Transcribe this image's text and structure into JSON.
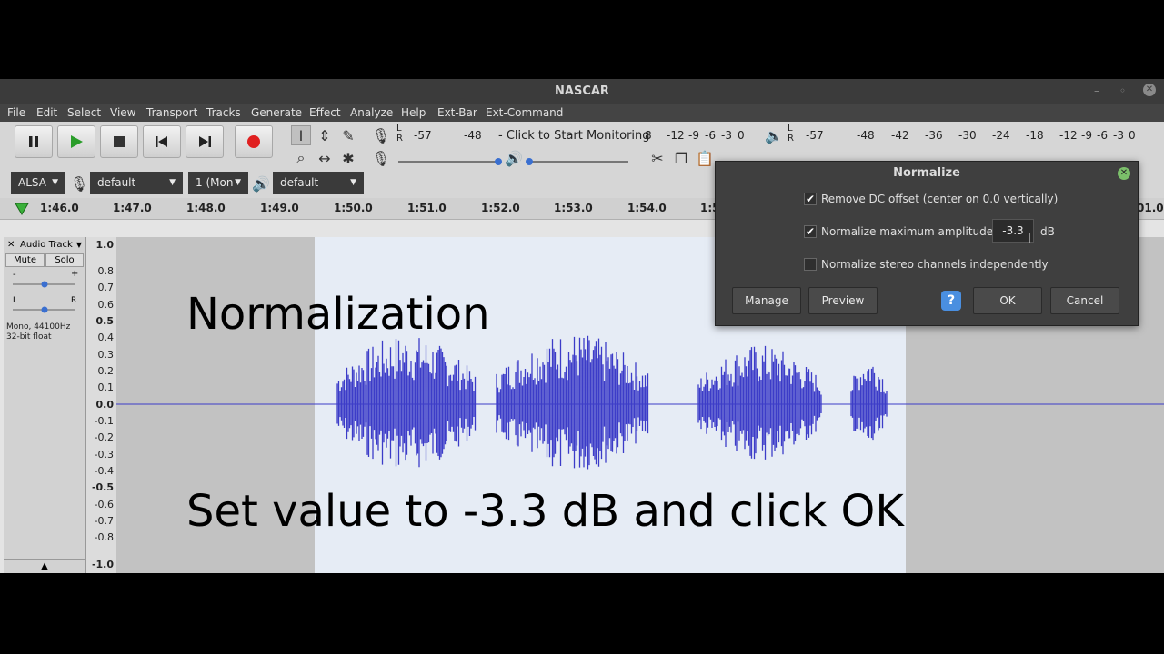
{
  "window": {
    "title": "NASCAR"
  },
  "menu": [
    "File",
    "Edit",
    "Select",
    "View",
    "Transport",
    "Tracks",
    "Generate",
    "Effect",
    "Analyze",
    "Help",
    "Ext-Bar",
    "Ext-Command"
  ],
  "meters": {
    "rec_ticks": [
      "-57",
      "-48"
    ],
    "rec_prompt": "- Click to Start Monitoring",
    "rec_tail": [
      "8",
      "-12",
      "-9",
      "-6",
      "-3",
      "0"
    ],
    "play_ticks": [
      "-57",
      "-48",
      "-42",
      "-36",
      "-30",
      "-24",
      "-18",
      "-12",
      "-9",
      "-6",
      "-3",
      "0"
    ],
    "lr": [
      "L",
      "R"
    ]
  },
  "device": {
    "host": "ALSA",
    "mic": "default",
    "channels": "1 (Mon",
    "speaker": "default"
  },
  "timeline": [
    "1:46.0",
    "1:47.0",
    "1:48.0",
    "1:49.0",
    "1:50.0",
    "1:51.0",
    "1:52.0",
    "1:53.0",
    "1:54.0",
    "1:5",
    "01.0"
  ],
  "track": {
    "name": "Audio Track",
    "mute": "Mute",
    "solo": "Solo",
    "gain_minus": "-",
    "gain_plus": "+",
    "pan_l": "L",
    "pan_r": "R",
    "info1": "Mono, 44100Hz",
    "info2": "32-bit float"
  },
  "vruler": [
    "1.0",
    "0.8",
    "0.7",
    "0.6",
    "0.5",
    "0.4",
    "0.3",
    "0.2",
    "0.1",
    "0.0",
    "-0.1",
    "-0.2",
    "-0.3",
    "-0.4",
    "-0.5",
    "-0.6",
    "-0.7",
    "-0.8",
    "-1.0"
  ],
  "captions": {
    "top": "Normalization",
    "bottom": "Set value to -3.3 dB and click OK"
  },
  "dialog": {
    "title": "Normalize",
    "opt_dc": "Remove DC offset (center on 0.0 vertically)",
    "opt_dc_checked": true,
    "opt_amp": "Normalize maximum amplitude to",
    "opt_amp_checked": true,
    "amp_value": "-3.3",
    "amp_unit": "dB",
    "opt_stereo": "Normalize stereo channels independently",
    "opt_stereo_checked": false,
    "btn_manage": "Manage",
    "btn_preview": "Preview",
    "btn_help": "?",
    "btn_ok": "OK",
    "btn_cancel": "Cancel"
  },
  "colors": {
    "waveform": "#3c3cc8",
    "selection": "#e6ecf5",
    "record": "#e02020",
    "play": "#2a9d2a"
  }
}
